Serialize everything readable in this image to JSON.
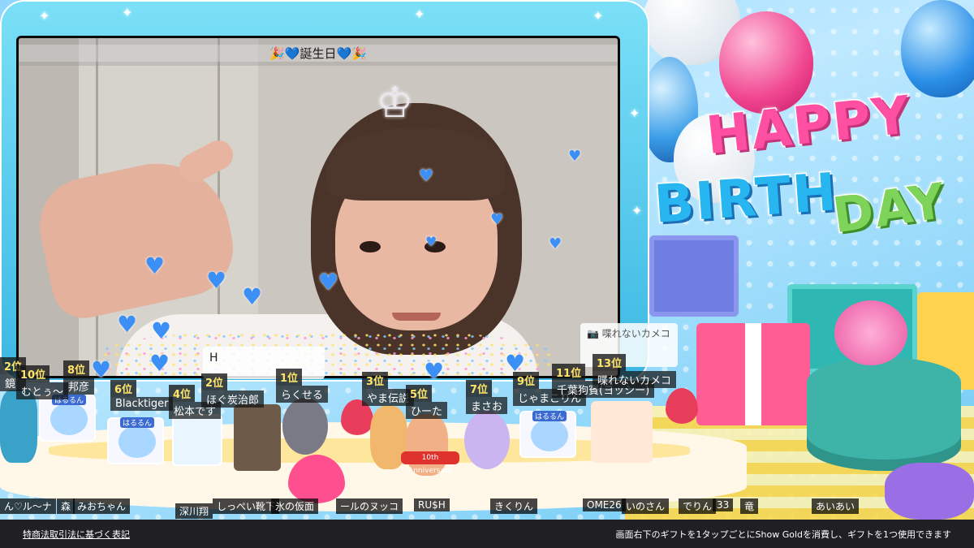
{
  "stream": {
    "video_title": "🎉💙誕生日💙🎉",
    "decor_text_line1": "HAPPY",
    "decor_text_line2": "BIRTH",
    "decor_text_line3": "DAY"
  },
  "comments": {
    "box1_text": "H",
    "box1_subtext": "ほぐ炭治郎",
    "box2_title": "喋れないカメコ"
  },
  "ranking": [
    {
      "pos": "2位",
      "name": "鏡"
    },
    {
      "pos": "10位",
      "name": "むとぅ〜"
    },
    {
      "pos": "8位",
      "name": "邦彦"
    },
    {
      "pos": "6位",
      "name": "Blacktiger"
    },
    {
      "pos": "4位",
      "name": "松本です"
    },
    {
      "pos": "2位",
      "name": "ほぐ炭治郎"
    },
    {
      "pos": "1位",
      "name": "らくせる"
    },
    {
      "pos": "3位",
      "name": "やま伝説"
    },
    {
      "pos": "5位",
      "name": "ひーた"
    },
    {
      "pos": "7位",
      "name": "まさお"
    },
    {
      "pos": "9位",
      "name": "じゃまこりん"
    },
    {
      "pos": "11位",
      "name": "千葉狗賓(ヨッシー)"
    },
    {
      "pos": "13位",
      "name": "喋れないカメコ"
    }
  ],
  "avatar_tag": "はるるん",
  "anniversary_tag": "10th Anniversary",
  "bottom_names": [
    "ん♡ル〜ナ",
    "森",
    "みおちゃん",
    "深川翔",
    "しっぺい靴下",
    "氷の仮面",
    "ールのヌッコ",
    "RU$H",
    "きくりん",
    "OME26",
    "いのさん",
    "でりん",
    "33",
    "竜",
    "あいあい"
  ],
  "footer": {
    "legal_link": "特商法取引法に基づく表記",
    "note": "画面右下のギフトを1タップごとにShow Goldを消費し、ギフトを1つ使用できます"
  },
  "colors": {
    "frame": "#3bb7e3",
    "heart": "#3b8ff5",
    "rank_pos": "#ffe66a",
    "footer_bg": "#1f1f24"
  },
  "icons": [
    "heart-icon",
    "sparkle-icon",
    "camera-icon",
    "balloon-icon"
  ]
}
